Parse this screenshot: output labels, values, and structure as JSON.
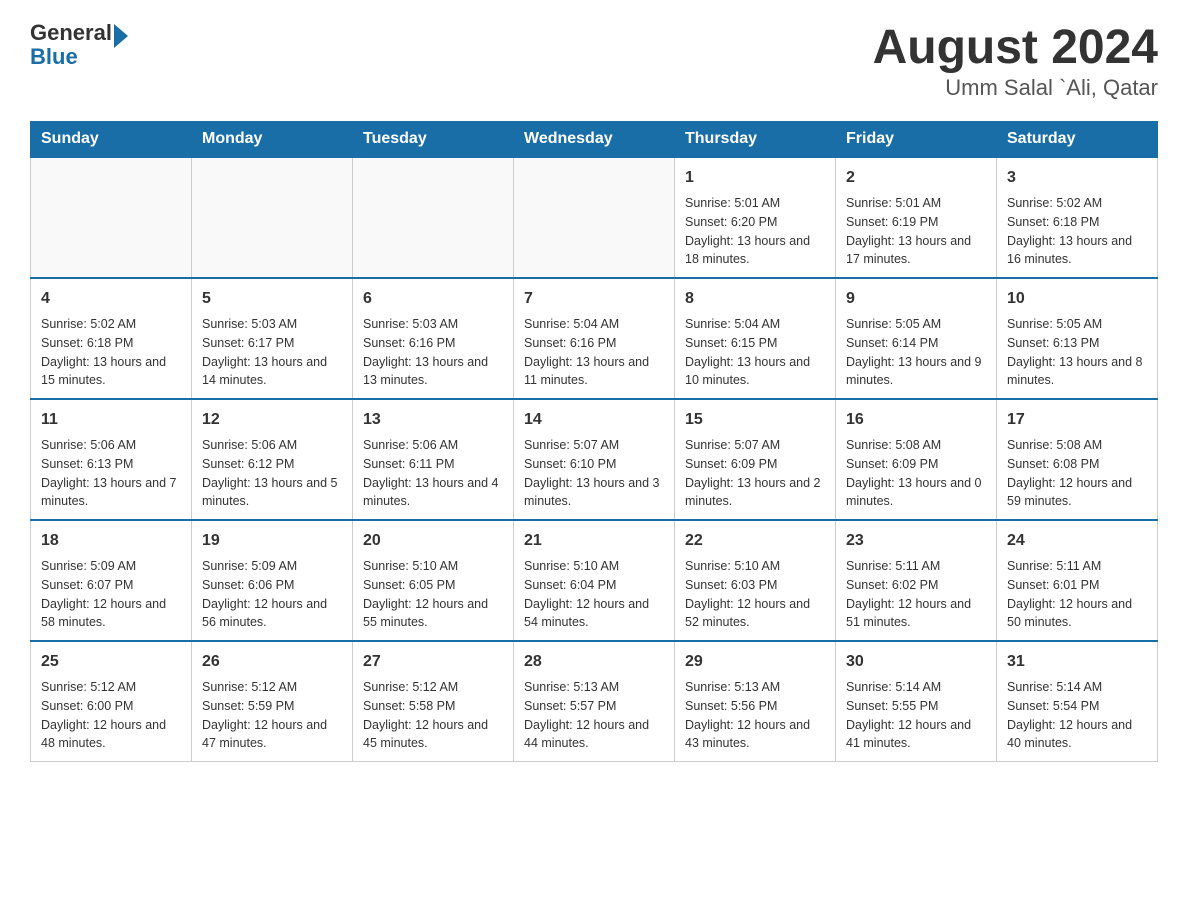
{
  "logo": {
    "text_general": "General",
    "text_blue": "Blue"
  },
  "header": {
    "month_title": "August 2024",
    "subtitle": "Umm Salal `Ali, Qatar"
  },
  "days_of_week": [
    "Sunday",
    "Monday",
    "Tuesday",
    "Wednesday",
    "Thursday",
    "Friday",
    "Saturday"
  ],
  "weeks": [
    {
      "cells": [
        {
          "day": null
        },
        {
          "day": null
        },
        {
          "day": null
        },
        {
          "day": null
        },
        {
          "day": 1,
          "sunrise": "5:01 AM",
          "sunset": "6:20 PM",
          "daylight": "13 hours and 18 minutes."
        },
        {
          "day": 2,
          "sunrise": "5:01 AM",
          "sunset": "6:19 PM",
          "daylight": "13 hours and 17 minutes."
        },
        {
          "day": 3,
          "sunrise": "5:02 AM",
          "sunset": "6:18 PM",
          "daylight": "13 hours and 16 minutes."
        }
      ]
    },
    {
      "cells": [
        {
          "day": 4,
          "sunrise": "5:02 AM",
          "sunset": "6:18 PM",
          "daylight": "13 hours and 15 minutes."
        },
        {
          "day": 5,
          "sunrise": "5:03 AM",
          "sunset": "6:17 PM",
          "daylight": "13 hours and 14 minutes."
        },
        {
          "day": 6,
          "sunrise": "5:03 AM",
          "sunset": "6:16 PM",
          "daylight": "13 hours and 13 minutes."
        },
        {
          "day": 7,
          "sunrise": "5:04 AM",
          "sunset": "6:16 PM",
          "daylight": "13 hours and 11 minutes."
        },
        {
          "day": 8,
          "sunrise": "5:04 AM",
          "sunset": "6:15 PM",
          "daylight": "13 hours and 10 minutes."
        },
        {
          "day": 9,
          "sunrise": "5:05 AM",
          "sunset": "6:14 PM",
          "daylight": "13 hours and 9 minutes."
        },
        {
          "day": 10,
          "sunrise": "5:05 AM",
          "sunset": "6:13 PM",
          "daylight": "13 hours and 8 minutes."
        }
      ]
    },
    {
      "cells": [
        {
          "day": 11,
          "sunrise": "5:06 AM",
          "sunset": "6:13 PM",
          "daylight": "13 hours and 7 minutes."
        },
        {
          "day": 12,
          "sunrise": "5:06 AM",
          "sunset": "6:12 PM",
          "daylight": "13 hours and 5 minutes."
        },
        {
          "day": 13,
          "sunrise": "5:06 AM",
          "sunset": "6:11 PM",
          "daylight": "13 hours and 4 minutes."
        },
        {
          "day": 14,
          "sunrise": "5:07 AM",
          "sunset": "6:10 PM",
          "daylight": "13 hours and 3 minutes."
        },
        {
          "day": 15,
          "sunrise": "5:07 AM",
          "sunset": "6:09 PM",
          "daylight": "13 hours and 2 minutes."
        },
        {
          "day": 16,
          "sunrise": "5:08 AM",
          "sunset": "6:09 PM",
          "daylight": "13 hours and 0 minutes."
        },
        {
          "day": 17,
          "sunrise": "5:08 AM",
          "sunset": "6:08 PM",
          "daylight": "12 hours and 59 minutes."
        }
      ]
    },
    {
      "cells": [
        {
          "day": 18,
          "sunrise": "5:09 AM",
          "sunset": "6:07 PM",
          "daylight": "12 hours and 58 minutes."
        },
        {
          "day": 19,
          "sunrise": "5:09 AM",
          "sunset": "6:06 PM",
          "daylight": "12 hours and 56 minutes."
        },
        {
          "day": 20,
          "sunrise": "5:10 AM",
          "sunset": "6:05 PM",
          "daylight": "12 hours and 55 minutes."
        },
        {
          "day": 21,
          "sunrise": "5:10 AM",
          "sunset": "6:04 PM",
          "daylight": "12 hours and 54 minutes."
        },
        {
          "day": 22,
          "sunrise": "5:10 AM",
          "sunset": "6:03 PM",
          "daylight": "12 hours and 52 minutes."
        },
        {
          "day": 23,
          "sunrise": "5:11 AM",
          "sunset": "6:02 PM",
          "daylight": "12 hours and 51 minutes."
        },
        {
          "day": 24,
          "sunrise": "5:11 AM",
          "sunset": "6:01 PM",
          "daylight": "12 hours and 50 minutes."
        }
      ]
    },
    {
      "cells": [
        {
          "day": 25,
          "sunrise": "5:12 AM",
          "sunset": "6:00 PM",
          "daylight": "12 hours and 48 minutes."
        },
        {
          "day": 26,
          "sunrise": "5:12 AM",
          "sunset": "5:59 PM",
          "daylight": "12 hours and 47 minutes."
        },
        {
          "day": 27,
          "sunrise": "5:12 AM",
          "sunset": "5:58 PM",
          "daylight": "12 hours and 45 minutes."
        },
        {
          "day": 28,
          "sunrise": "5:13 AM",
          "sunset": "5:57 PM",
          "daylight": "12 hours and 44 minutes."
        },
        {
          "day": 29,
          "sunrise": "5:13 AM",
          "sunset": "5:56 PM",
          "daylight": "12 hours and 43 minutes."
        },
        {
          "day": 30,
          "sunrise": "5:14 AM",
          "sunset": "5:55 PM",
          "daylight": "12 hours and 41 minutes."
        },
        {
          "day": 31,
          "sunrise": "5:14 AM",
          "sunset": "5:54 PM",
          "daylight": "12 hours and 40 minutes."
        }
      ]
    }
  ],
  "labels": {
    "sunrise": "Sunrise:",
    "sunset": "Sunset:",
    "daylight": "Daylight:"
  }
}
